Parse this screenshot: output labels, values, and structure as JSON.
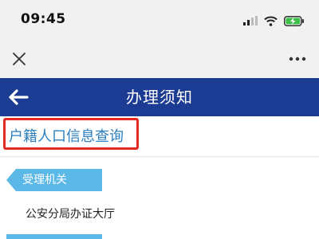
{
  "status_bar": {
    "time": "09:45",
    "icons": [
      "signal-icon",
      "wifi-icon",
      "battery-charging-icon"
    ]
  },
  "nav_bar": {
    "close_icon": "close-icon",
    "more_icon": "more-icon"
  },
  "header": {
    "back_icon": "back-arrow-icon",
    "title": "办理须知",
    "background_color": "#1c3b92"
  },
  "page": {
    "title": "户籍人口信息查询",
    "title_color": "#2b7fbf",
    "highlight_color": "#e22a22"
  },
  "sections": [
    {
      "label": "受理机关",
      "value": "公安分局办证大厅",
      "tag_color": "#5cb8e6"
    }
  ]
}
